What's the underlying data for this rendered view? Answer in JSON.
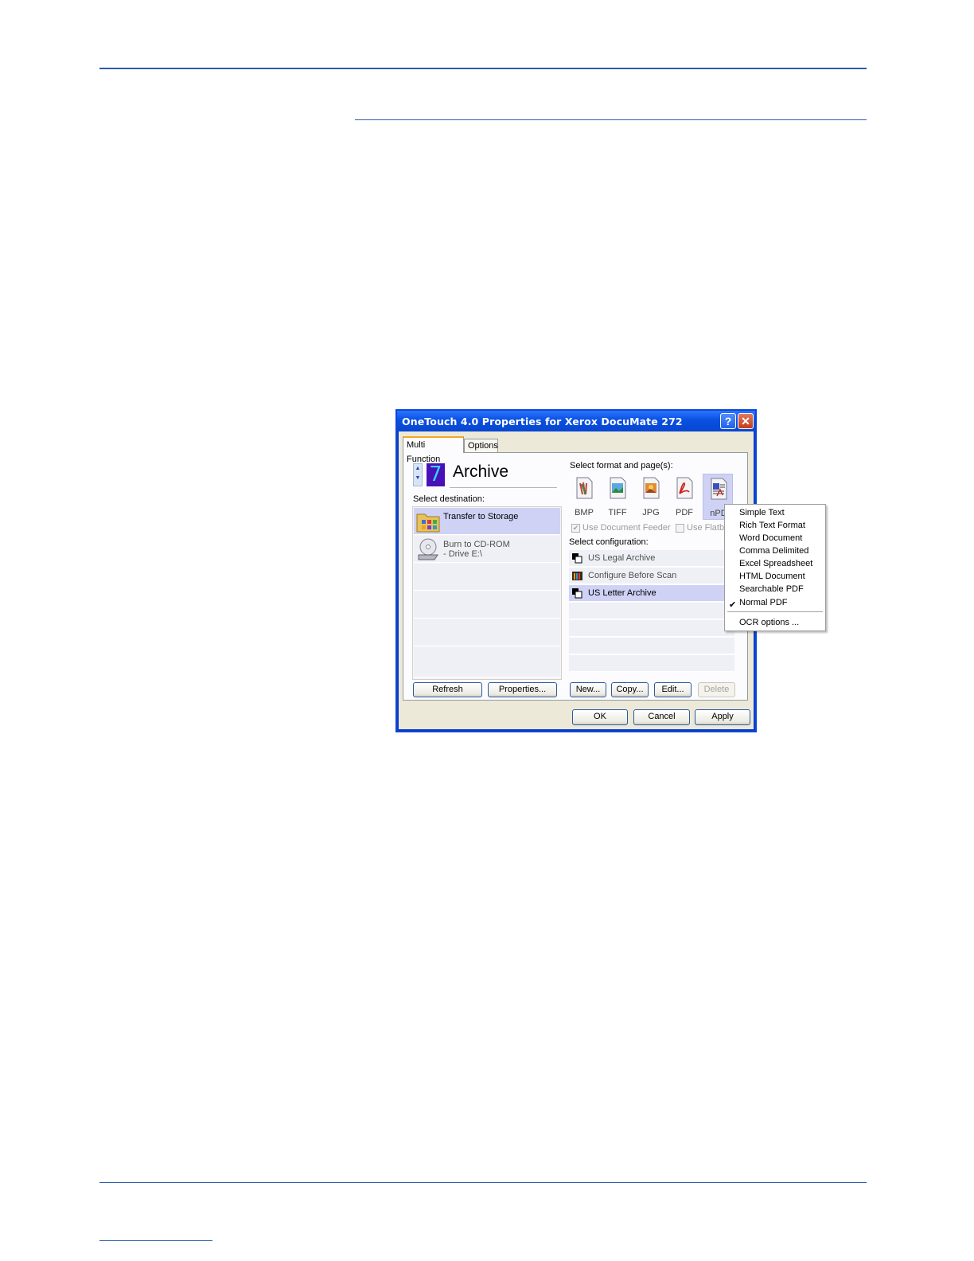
{
  "window": {
    "title": "OneTouch 4.0 Properties for Xerox DocuMate 272",
    "help_glyph": "?",
    "close_glyph": "✕"
  },
  "tabs": [
    {
      "label": "Multi Function",
      "active": true
    },
    {
      "label": "Options",
      "active": false
    }
  ],
  "event": {
    "number": "7",
    "name": "Archive"
  },
  "destination": {
    "label": "Select destination:",
    "items": [
      {
        "line1": "Transfer to Storage",
        "line2": "",
        "selected": true,
        "icon": "folder-icon"
      },
      {
        "line1": "Burn to CD-ROM",
        "line2": "- Drive E:\\",
        "selected": false,
        "icon": "cd-drive-icon"
      }
    ]
  },
  "format": {
    "label": "Select format and page(s):",
    "items": [
      {
        "label": "BMP",
        "icon": "bmp-icon",
        "selected": false
      },
      {
        "label": "TIFF",
        "icon": "tiff-icon",
        "selected": false
      },
      {
        "label": "JPG",
        "icon": "jpg-icon",
        "selected": false
      },
      {
        "label": "PDF",
        "icon": "pdf-icon",
        "selected": false
      },
      {
        "label": "nPD",
        "icon": "npdf-icon",
        "selected": true
      }
    ]
  },
  "feeder": {
    "adf_label": "Use Document Feeder",
    "adf_checked": true,
    "flatbed_label": "Use Flatbe",
    "flatbed_checked": false
  },
  "configuration": {
    "label": "Select configuration:",
    "items": [
      {
        "label": "US Legal Archive",
        "selected": false,
        "icon": "scan-config-icon"
      },
      {
        "label": "Configure Before Scan",
        "selected": false,
        "icon": "configure-icon"
      },
      {
        "label": "US Letter Archive",
        "selected": true,
        "icon": "scan-config-icon"
      }
    ]
  },
  "buttons": {
    "refresh": "Refresh",
    "properties": "Properties...",
    "new": "New...",
    "copy": "Copy...",
    "edit": "Edit...",
    "delete": "Delete",
    "ok": "OK",
    "cancel": "Cancel",
    "apply": "Apply"
  },
  "popup_menu": {
    "items": [
      {
        "label": "Simple Text",
        "checked": false
      },
      {
        "label": "Rich Text Format",
        "checked": false
      },
      {
        "label": "Word Document",
        "checked": false
      },
      {
        "label": "Comma Delimited",
        "checked": false
      },
      {
        "label": "Excel Spreadsheet",
        "checked": false
      },
      {
        "label": "HTML Document",
        "checked": false
      },
      {
        "label": "Searchable PDF",
        "checked": false
      },
      {
        "label": "Normal PDF",
        "checked": true
      }
    ],
    "ocr_options": "OCR options ...",
    "check_glyph": "✔"
  },
  "colors": {
    "accent_rule": "#2a5caa",
    "titlebar": "#0950e0",
    "selection": "#cfd2f5"
  }
}
